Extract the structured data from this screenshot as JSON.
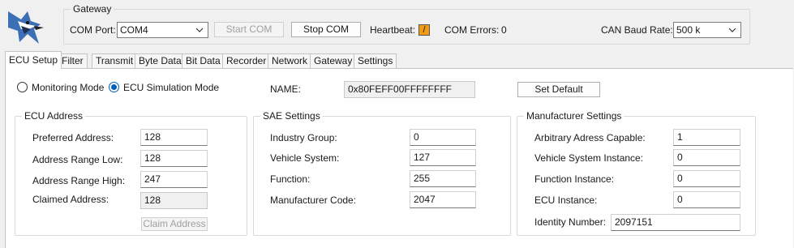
{
  "gateway": {
    "title": "Gateway",
    "com_port_label": "COM Port:",
    "com_port_value": "COM4",
    "start_com_label": "Start COM",
    "stop_com_label": "Stop COM",
    "heartbeat_label": "Heartbeat:",
    "heartbeat_glyph": "/",
    "heartbeat_color": "#f39c12",
    "com_errors_label": "COM Errors:",
    "com_errors_value": "0",
    "baud_label": "CAN Baud Rate:",
    "baud_value": "500 k"
  },
  "tabs": [
    "ECU Setup",
    "Filter",
    "Transmit",
    "Byte Data",
    "Bit Data",
    "Recorder",
    "Network",
    "Gateway",
    "Settings"
  ],
  "mode": {
    "monitoring_label": "Monitoring Mode",
    "simulation_label": "ECU Simulation Mode",
    "selected": "ECU Simulation Mode"
  },
  "name_label": "NAME:",
  "name_value": "0x80FEFF00FFFFFFFF",
  "set_default_label": "Set Default",
  "ecu_address": {
    "title": "ECU Address",
    "preferred_label": "Preferred Address:",
    "preferred_value": "128",
    "range_low_label": "Address Range Low:",
    "range_low_value": "128",
    "range_high_label": "Address Range High:",
    "range_high_value": "247",
    "claimed_label": "Claimed Address:",
    "claimed_value": "128",
    "claim_button_label": "Claim Address"
  },
  "sae": {
    "title": "SAE Settings",
    "industry_label": "Industry Group:",
    "industry_value": "0",
    "vehicle_label": "Vehicle System:",
    "vehicle_value": "127",
    "function_label": "Function:",
    "function_value": "255",
    "manufacturer_label": "Manufacturer Code:",
    "manufacturer_value": "2047"
  },
  "manufacturer": {
    "title": "Manufacturer Settings",
    "arbitrary_label": "Arbitrary Adress Capable:",
    "arbitrary_value": "1",
    "vehicle_instance_label": "Vehicle System Instance:",
    "vehicle_instance_value": "0",
    "function_instance_label": "Function Instance:",
    "function_instance_value": "0",
    "ecu_instance_label": "ECU Instance:",
    "ecu_instance_value": "0",
    "identity_label": "Identity Number:",
    "identity_value": "2097151"
  },
  "colors": {
    "accent": "#005fb8",
    "logo_blue": "#3b6fb6"
  },
  "icons": {
    "logo": "bird-logo-icon",
    "dropdown": "chevron-down-icon"
  }
}
